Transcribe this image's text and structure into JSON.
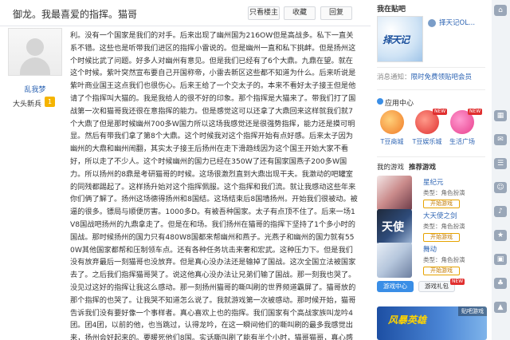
{
  "post_header": {
    "title": "御龙。我最喜爱的指挥。猫哥",
    "buttons": [
      {
        "label": "只看楼主"
      },
      {
        "label": "收藏"
      },
      {
        "label": "回复"
      }
    ]
  },
  "author": {
    "name": "乱我梦",
    "level_title": "大头新兵",
    "level_badge": "1"
  },
  "post_text": "利。没有一个国家是我们的对手。后来出现了幽州国为216OW但是高战多。私下一直关系不错。这些也是听带我们进区的指挥小雷说的。但是幽州一直和私下挑衅。但是扬州这个时候比武了问题。好多人对幽州有意见。但是我们已经有了6个大鼎。九鼎在望。就在这个时候。紫叶突然宣布要自己开国称帝，小雷去新区这些都不知道为什么。后来听说是紫叶商业国王这点我们也很伤心。后来王给了一个交太子的。本来不看好太子接王但是他请了个指挥叫大猫的。我是我给人的很不好的印象。那个指挥是大猫来了。带我们打了国战第一次和猫哥我还很在意指挥的能力。但是感觉这可以还拿了大鼎回来这样就我们就7个大鼎了但是那时候幽州700多W国力所以这场我感觉还是很强势指挥，能力还是摸可明显。然后有带我们拿了第8个大鼎。这个时候我对这个指挥开始有点好感。后来太子因为幽州的大鼎和幽州闹翻，其实太子接王后扬州在走下滑趋线因为这个国王开始大家不看好，所以走了不少人。这个时候幽州的国力已经在350W了还有国家国燕子200多W国力。所以扬州的8鼎是考研猫哥的时候。这场很激烈直到大鼎出现干夫。我激动的吧罐室的同残都踢起了。这样扬升始对这个指挥佩服。这个指挥和我们流。就让我感动这些年来你们俩了解了。扬州这场德得扬州和8国结。这场结束后8国墙扬州。开始我们很被动。被逼的很多。镖局与顺便厉害。1000多D。有被吾种国家。太子有点顶不住了。后来一场1V8国战吧扬州的九鼎拿走了。但是在和场。我们扬州在猫哥的指挥下坚持了1个多小时的国战。那时候扬州的国力只有480W8国都来帮幽州和燕子。光燕子和幽州的国力就有550W其他国家都帮和压制领车点。还有各种任务坑击来奢和宏武。这种压力下。但是我们没有放弃最后一刻猫哥也没放弃。但是真心没办法还是输掉了国战。这次全国立法被国家去了。之后我们指挥猫哥哭了。说这他真心没办法让兄弟们输了国战。那一刻我也哭了。没见过这好的指挥让我这么感动。那一刻扬州猫哥的嘶叫刷的世界频道霸屏了。猫哥放的那个指挥的也哭了。让我哭不知道怎么说了。我就游戏第一次被感动。那时候开始，猫哥告诉我们没有要好像一个事样者。真心喜欢上也的指挥。我们国家有个高战家族叫龙吟4团。团4团，以前的他，也当跳过，认得龙吟，在这一瞬间他们的嘶叫刷的最多我感觉出来，扬州会好起来的。要暖死他们8国。实话嘶叫刷了能有半个小时，猫哥猫哥，真心感动了扬州。后来我们的国越人越来越多。不防守就是被踢。我那时候上课只要有时间就上网一听见QT我就和猫哥去砸车。后来也就感觉御龙这个游戏好玩。有感",
  "sidebar": {
    "section_title": "我在贴吧",
    "bar_logo_text": "择天记",
    "bar_user": "择天记OL...",
    "message_label": "消息通知：",
    "message_text": "限时免费领贴吧会员",
    "app_center_title": "应用中心",
    "apps": [
      {
        "label": "T豆商城",
        "new": ""
      },
      {
        "label": "T豆娱乐城",
        "new": "NEW"
      },
      {
        "label": "生活广场",
        "new": "NEW"
      }
    ],
    "my_games_title": "我的游戏",
    "recommended_title": "推荐游戏",
    "games": [
      {
        "name": "星纪元",
        "type": "类型：角色扮演",
        "button": "开始游戏",
        "img_text": ""
      },
      {
        "name": "大天使之剑",
        "type": "类型：角色扮演",
        "button": "开始游戏",
        "img_text": "天使"
      },
      {
        "name": "舞动",
        "type": "类型：角色扮演",
        "button": "开始游戏",
        "img_text": ""
      }
    ],
    "game_center_btn": "游戏中心",
    "gift_btn": "游戏礼包",
    "gift_new": "NEW",
    "banner_title": "风暴英雄",
    "banner_tag": "贴吧游戏"
  },
  "colors": {
    "link_blue": "#2d64b3",
    "accent_blue": "#3a8ee6",
    "new_red": "#e02f2f",
    "level_gold": "#f5b400"
  }
}
